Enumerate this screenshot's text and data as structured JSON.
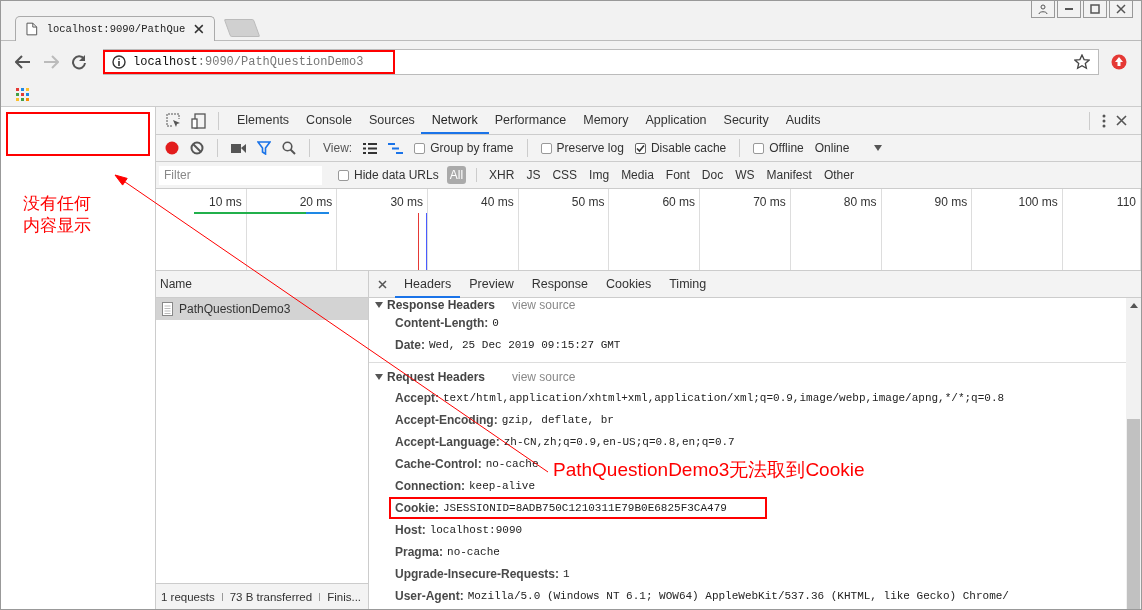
{
  "browser": {
    "tab": {
      "title": "localhost:9090/PathQue"
    },
    "address": {
      "host": "localhost",
      "rest": ":9090/PathQuestionDemo3",
      "highlighted": true
    }
  },
  "page": {
    "note": "没有任何内容显示"
  },
  "devtools": {
    "tabs": [
      {
        "label": "Elements",
        "selected": false
      },
      {
        "label": "Console",
        "selected": false
      },
      {
        "label": "Sources",
        "selected": false
      },
      {
        "label": "Network",
        "selected": true
      },
      {
        "label": "Performance",
        "selected": false
      },
      {
        "label": "Memory",
        "selected": false
      },
      {
        "label": "Application",
        "selected": false
      },
      {
        "label": "Security",
        "selected": false
      },
      {
        "label": "Audits",
        "selected": false
      }
    ],
    "toolbar": {
      "view_label": "View:",
      "option_groups": [
        [
          {
            "label": "Group by frame",
            "checked": false
          }
        ],
        [
          {
            "label": "Preserve log",
            "checked": false
          },
          {
            "label": "Disable cache",
            "checked": true
          }
        ],
        [
          {
            "label": "Offline",
            "checked": false
          }
        ]
      ],
      "throttle": "Online"
    },
    "filter": {
      "placeholder": "Filter",
      "hide_data_urls": {
        "label": "Hide data URLs",
        "checked": false
      },
      "types": [
        {
          "label": "All",
          "selected": true
        },
        {
          "label": "XHR",
          "selected": false
        },
        {
          "label": "JS",
          "selected": false
        },
        {
          "label": "CSS",
          "selected": false
        },
        {
          "label": "Img",
          "selected": false
        },
        {
          "label": "Media",
          "selected": false
        },
        {
          "label": "Font",
          "selected": false
        },
        {
          "label": "Doc",
          "selected": false
        },
        {
          "label": "WS",
          "selected": false
        },
        {
          "label": "Manifest",
          "selected": false
        },
        {
          "label": "Other",
          "selected": false
        }
      ]
    },
    "timeline": {
      "ticks": [
        "10 ms",
        "20 ms",
        "30 ms",
        "40 ms",
        "50 ms",
        "60 ms",
        "70 ms",
        "80 ms",
        "90 ms",
        "100 ms",
        "110"
      ]
    },
    "requests": {
      "header": "Name",
      "rows": [
        {
          "name": "PathQuestionDemo3",
          "selected": true
        }
      ],
      "status": [
        "1 requests",
        "73 B transferred",
        "Finis..."
      ]
    },
    "details": {
      "tabs": [
        {
          "label": "Headers",
          "selected": true
        },
        {
          "label": "Preview",
          "selected": false
        },
        {
          "label": "Response",
          "selected": false
        },
        {
          "label": "Cookies",
          "selected": false
        },
        {
          "label": "Timing",
          "selected": false
        }
      ],
      "sections": [
        {
          "title": "Response Headers",
          "link": "view source",
          "expanded": true,
          "headers": [
            {
              "name": "Content-Length:",
              "value": "0",
              "highlighted": false
            },
            {
              "name": "Date:",
              "value": "Wed, 25 Dec 2019 09:15:27 GMT",
              "highlighted": false
            }
          ]
        },
        {
          "title": "Request Headers",
          "link": "view source",
          "expanded": true,
          "headers": [
            {
              "name": "Accept:",
              "value": "text/html,application/xhtml+xml,application/xml;q=0.9,image/webp,image/apng,*/*;q=0.8",
              "highlighted": false
            },
            {
              "name": "Accept-Encoding:",
              "value": "gzip, deflate, br",
              "highlighted": false
            },
            {
              "name": "Accept-Language:",
              "value": "zh-CN,zh;q=0.9,en-US;q=0.8,en;q=0.7",
              "highlighted": false
            },
            {
              "name": "Cache-Control:",
              "value": "no-cache",
              "highlighted": false
            },
            {
              "name": "Connection:",
              "value": "keep-alive",
              "highlighted": false
            },
            {
              "name": "Cookie:",
              "value": "JSESSIONID=8ADB750C1210311E79B0E6825F3CA479",
              "highlighted": true
            },
            {
              "name": "Host:",
              "value": "localhost:9090",
              "highlighted": false
            },
            {
              "name": "Pragma:",
              "value": "no-cache",
              "highlighted": false
            },
            {
              "name": "Upgrade-Insecure-Requests:",
              "value": "1",
              "highlighted": false
            },
            {
              "name": "User-Agent:",
              "value": "Mozilla/5.0 (Windows NT 6.1; WOW64) AppleWebKit/537.36 (KHTML, like Gecko) Chrome/",
              "highlighted": false
            }
          ]
        }
      ]
    }
  },
  "annotations": [
    {
      "text": "PathQuestionDemo3无法取到Cookie"
    }
  ]
}
